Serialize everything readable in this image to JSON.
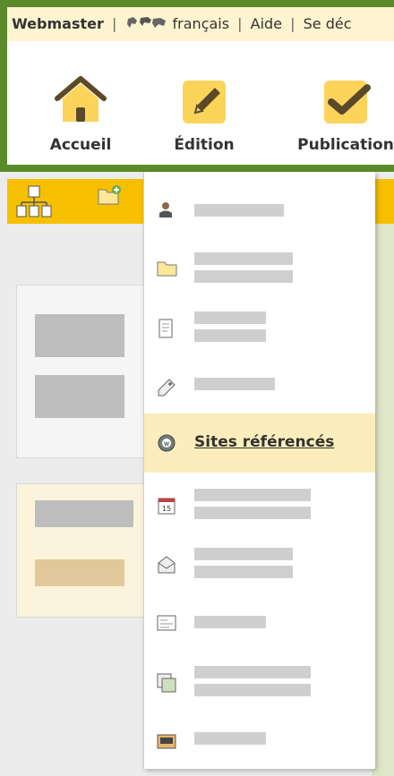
{
  "topbar": {
    "user": "Webmaster",
    "separator": "|",
    "language": "français",
    "help": "Aide",
    "logout": "Se déc"
  },
  "nav": [
    {
      "label": "Accueil",
      "icon": "home-icon"
    },
    {
      "label": "Édition",
      "icon": "pencil-icon"
    },
    {
      "label": "Publication",
      "icon": "checkmark-icon"
    }
  ],
  "toolbar": {
    "icons": [
      "sitemap-icon",
      "new-folder-icon"
    ]
  },
  "dropdown": {
    "items": [
      {
        "icon": "user-icon",
        "label": ""
      },
      {
        "icon": "folder-icon",
        "label": ""
      },
      {
        "icon": "document-icon",
        "label": ""
      },
      {
        "icon": "tag-icon",
        "label": ""
      },
      {
        "icon": "web-site-icon",
        "label": "Sites référencés",
        "active": true
      },
      {
        "icon": "calendar-icon",
        "label": "",
        "calendar_day": "15"
      },
      {
        "icon": "envelope-icon",
        "label": ""
      },
      {
        "icon": "form-icon",
        "label": ""
      },
      {
        "icon": "images-icon",
        "label": ""
      },
      {
        "icon": "drawer-icon",
        "label": ""
      }
    ]
  },
  "colors": {
    "frame": "#5a8a2a",
    "topbar_bg": "#fff4d0",
    "toolbar_bg": "#f6c000",
    "icon_yellow": "#fcd45a",
    "active_item_bg": "#fbeebc"
  }
}
